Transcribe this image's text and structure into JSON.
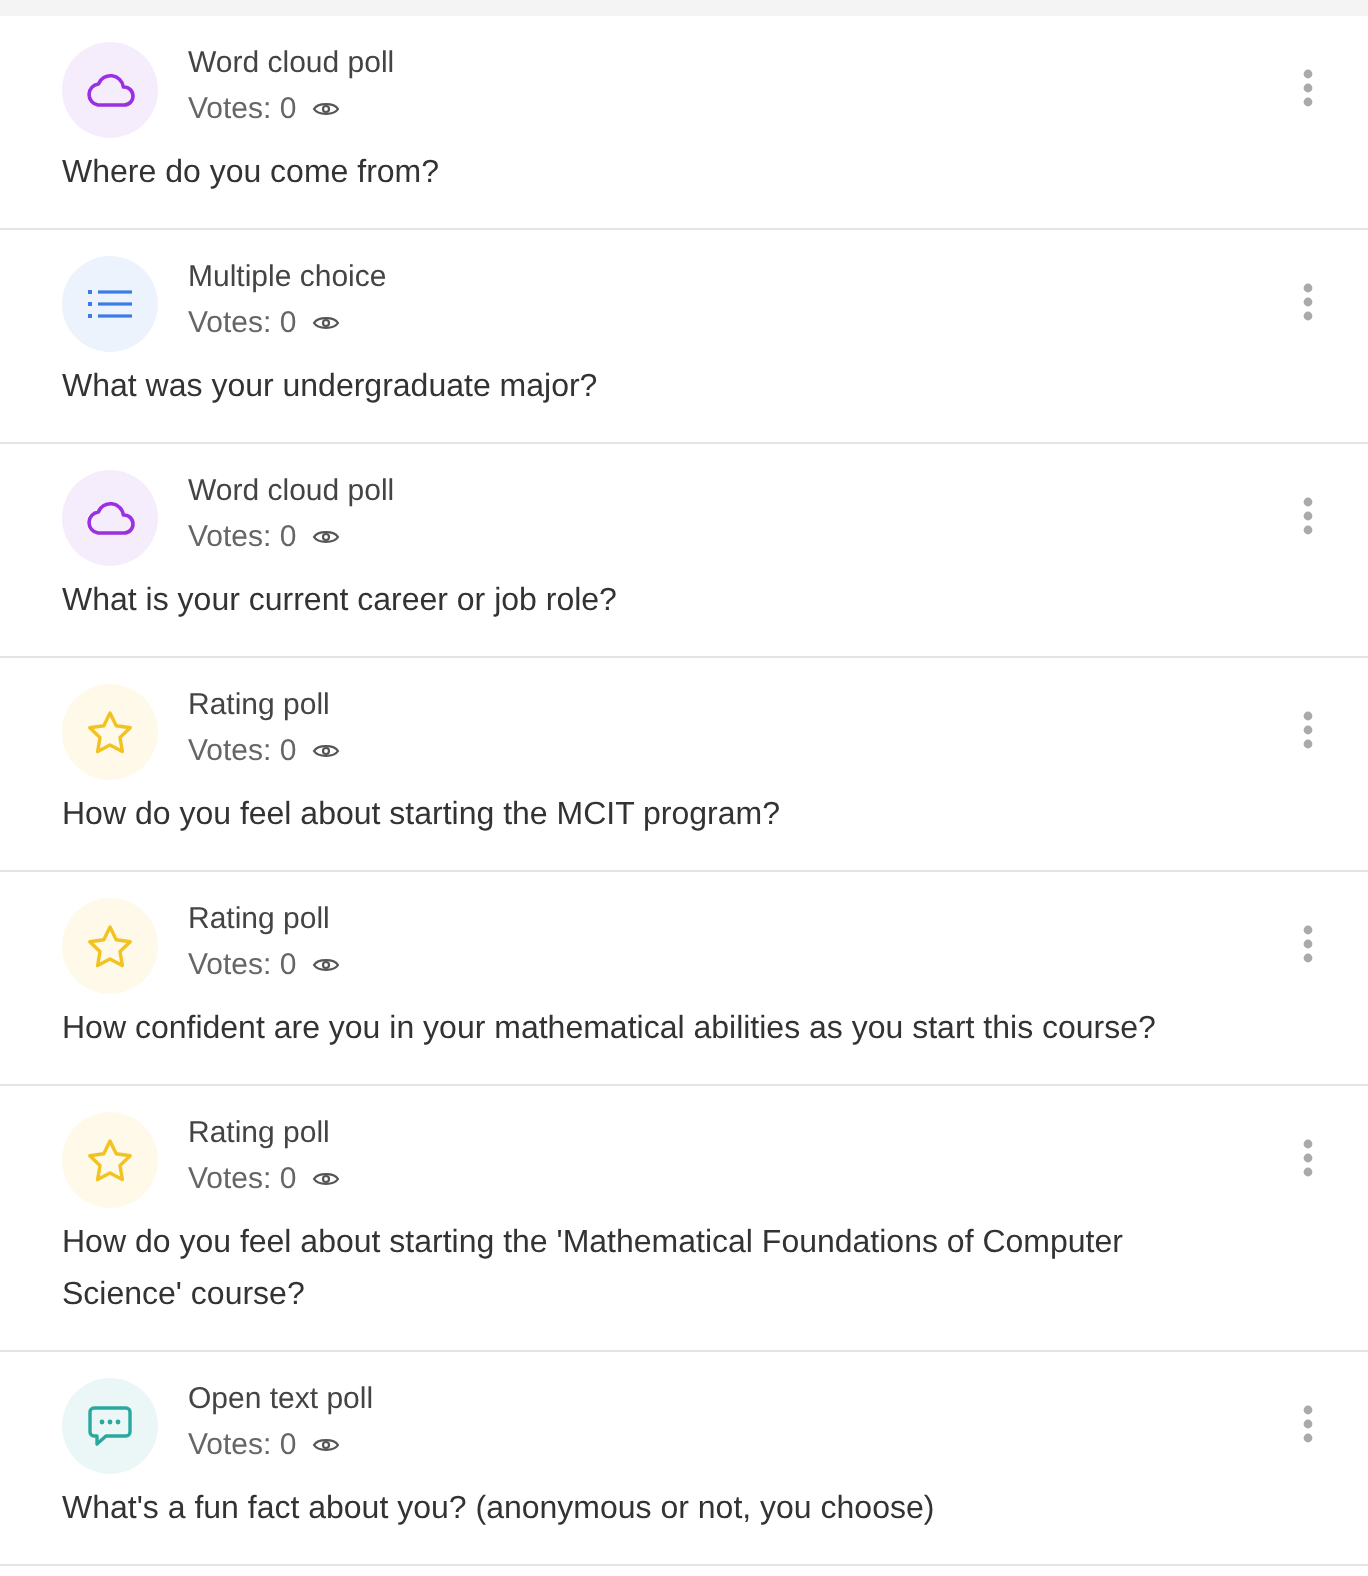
{
  "polls": [
    {
      "kind": "cloud",
      "type": "Word cloud poll",
      "votes": "Votes: 0",
      "question": "Where do you come from?"
    },
    {
      "kind": "list",
      "type": "Multiple choice",
      "votes": "Votes: 0",
      "question": "What was your undergraduate major?"
    },
    {
      "kind": "cloud",
      "type": "Word cloud poll",
      "votes": "Votes: 0",
      "question": "What is your current career or job role?"
    },
    {
      "kind": "star",
      "type": "Rating poll",
      "votes": "Votes: 0",
      "question": "How do you feel about starting the MCIT program?"
    },
    {
      "kind": "star",
      "type": "Rating poll",
      "votes": "Votes: 0",
      "question": "How confident are you in your mathematical abilities as you start this course?"
    },
    {
      "kind": "star",
      "type": "Rating poll",
      "votes": "Votes: 0",
      "question": "How do you feel about starting the 'Mathematical Foundations of Computer Science' course?"
    },
    {
      "kind": "chat",
      "type": "Open text poll",
      "votes": "Votes: 0",
      "question": "What's a fun fact about you? (anonymous or not, you choose)"
    }
  ]
}
